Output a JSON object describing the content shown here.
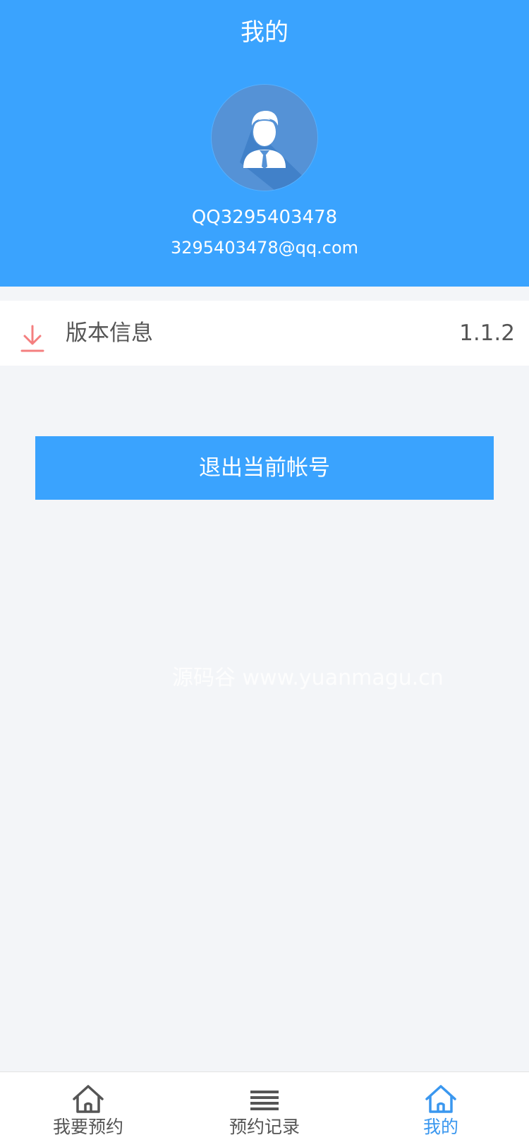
{
  "header": {
    "title": "我的",
    "username": "QQ3295403478",
    "email": "3295403478@qq.com"
  },
  "settings": {
    "version_label": "版本信息",
    "version_value": "1.1.2"
  },
  "actions": {
    "logout_label": "退出当前帐号"
  },
  "watermark": "源码谷 www.yuanmagu.cn",
  "tabs": [
    {
      "label": "我要预约",
      "icon": "home-icon",
      "active": false
    },
    {
      "label": "预约记录",
      "icon": "list-icon",
      "active": false
    },
    {
      "label": "我的",
      "icon": "home-icon",
      "active": true
    }
  ],
  "colors": {
    "primary": "#3aa3fe",
    "tab_active": "#3a97ef",
    "download_icon": "#f47f7f"
  }
}
